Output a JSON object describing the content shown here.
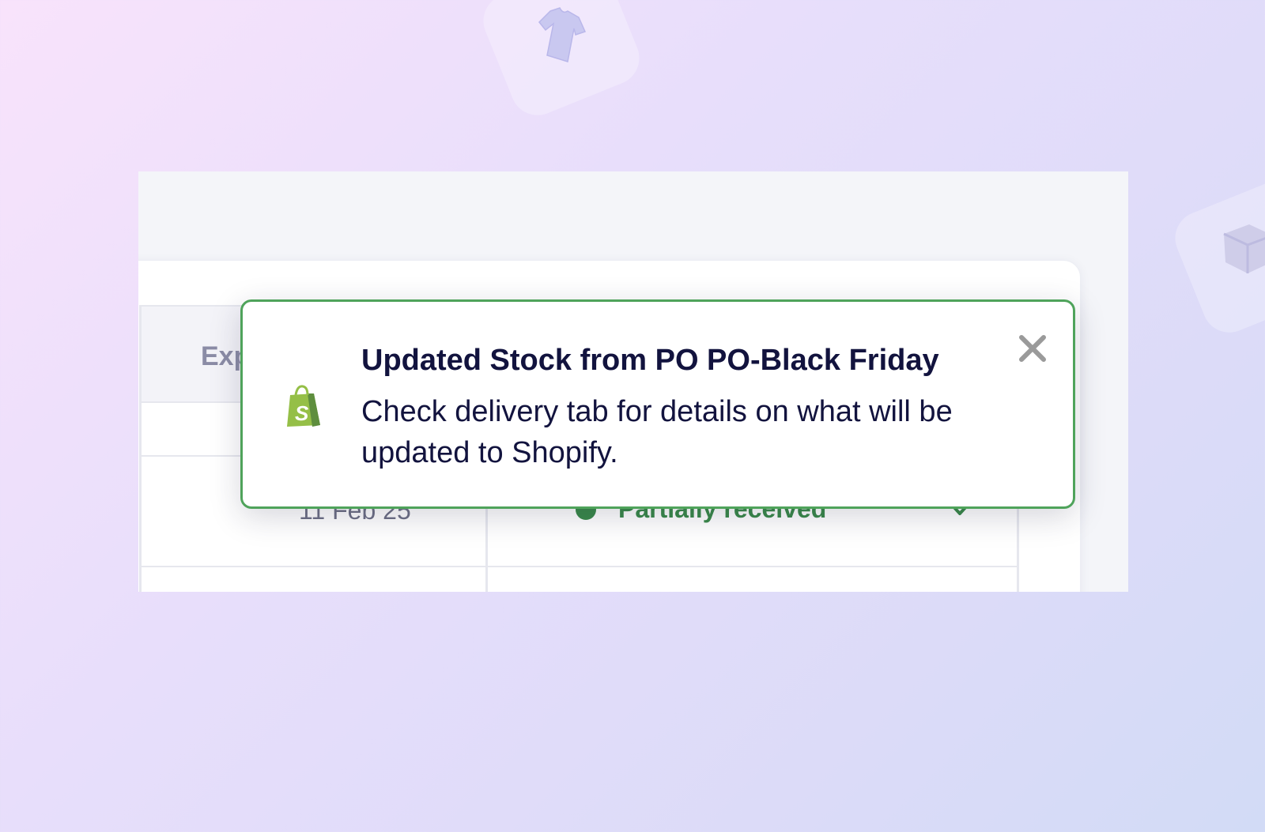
{
  "background": {
    "decorations": [
      {
        "icon": "shirt-icon"
      },
      {
        "icon": "box-icon"
      }
    ]
  },
  "table": {
    "header": {
      "expected_label": "Expec"
    },
    "rows": [
      {
        "date": "11 Feb 25",
        "status": "Partially received",
        "status_color": "#3a8a4a"
      }
    ]
  },
  "toast": {
    "icon": "shopify-bag-icon",
    "title": "Updated Stock from PO PO-Black Friday",
    "body": "Check delivery tab for details on what will be updated to Shopify.",
    "border_color": "#4fa35b",
    "close_icon": "close-icon"
  }
}
